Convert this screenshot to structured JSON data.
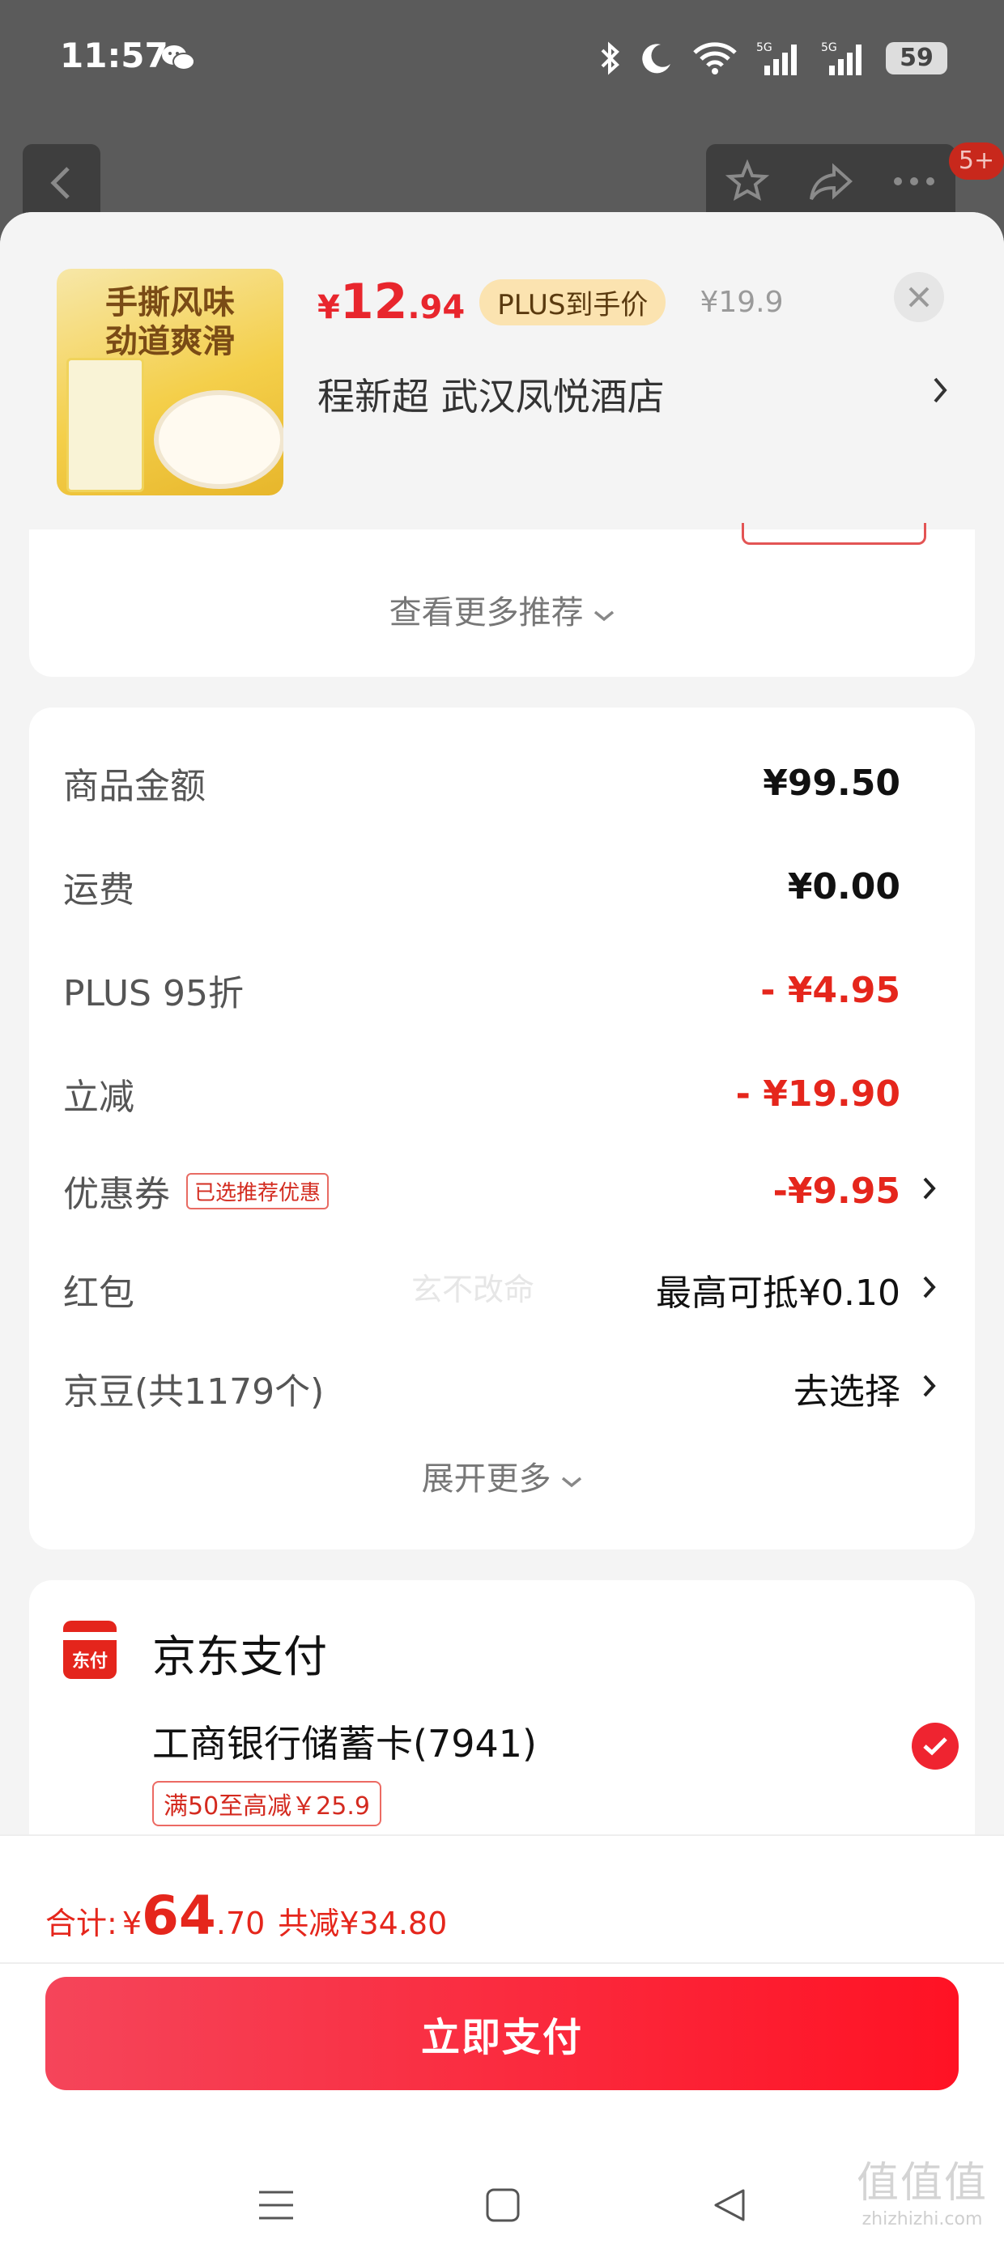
{
  "status_bar": {
    "time": "11:57",
    "battery": "59",
    "signal_1_label": "5G",
    "signal_2_label": "5G"
  },
  "nav": {
    "badge": "5+"
  },
  "product": {
    "currency": "¥",
    "price_int": "12",
    "price_dec": ".94",
    "plus_label": "PLUS到手价",
    "original_price": "¥19.9",
    "address": "程新超  武汉凤悦酒店",
    "thumb_text_line1": "手撕风味",
    "thumb_text_line2": "劲道爽滑"
  },
  "recommend": {
    "more_label": "查看更多推荐"
  },
  "summary": {
    "rows": [
      {
        "label": "商品金额",
        "value": "¥99.50"
      },
      {
        "label": "运费",
        "value": "¥0.00"
      },
      {
        "label": "PLUS 95折",
        "value": "- ¥4.95"
      },
      {
        "label": "立减",
        "value": "- ¥19.90"
      },
      {
        "label": "优惠券",
        "tag": "已选推荐优惠",
        "value": "-¥9.95"
      },
      {
        "label": "红包",
        "value": "最高可抵¥0.10"
      },
      {
        "label": "京豆(共1179个)",
        "value": "去选择"
      }
    ],
    "expand_label": "展开更多",
    "watermark": "玄不改命"
  },
  "payment": {
    "icon_label": "东付",
    "title": "京东支付",
    "bank": "工商银行储蓄卡(7941)",
    "promo": "满50至高减￥25.9"
  },
  "bottom": {
    "total_label": "合计:",
    "currency": "¥",
    "total_int": "64",
    "total_dec": ".70",
    "saved": "共减¥34.80",
    "pay_button": "立即支付"
  },
  "corner_watermark": {
    "line1": "值值值",
    "line2": "zhizhizhi.com"
  },
  "colors": {
    "accent_red": "#e5261c",
    "pay_button": "#ff1224",
    "plus_pill": "#fbe3b0"
  }
}
